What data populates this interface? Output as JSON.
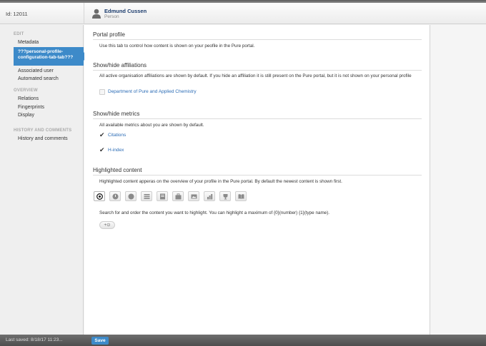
{
  "header": {
    "id_label": "Id: 12011",
    "person_name": "Edmund Cussen",
    "person_type": "Person"
  },
  "sidebar": {
    "sections": [
      {
        "title": "EDIT"
      },
      {
        "title": "OVERVIEW"
      },
      {
        "title": "HISTORY AND COMMENTS"
      }
    ],
    "items": [
      {
        "label": "Metadata"
      },
      {
        "label": "???personal-profile-configuration-tab-tab???"
      },
      {
        "label": "Associated user"
      },
      {
        "label": "Automated search"
      },
      {
        "label": "Relations"
      },
      {
        "label": "Fingerprints"
      },
      {
        "label": "Display"
      },
      {
        "label": "History and comments"
      }
    ],
    "accent_color": "#3d8ac9"
  },
  "main": {
    "portal_profile": {
      "title": "Portal profile",
      "description": "Use this tab to control how content is shown on your peofile in the Pure portal."
    },
    "affiliations": {
      "title": "Show/hide affiliations",
      "description": "All active organisation affiliations are shown by default. If you hide an affiliation it is still present on the Pure portal, but it is not shown on your personal profile",
      "items": [
        {
          "label": "Department of Pure and Applied Chemistry",
          "checked": false
        }
      ]
    },
    "metrics": {
      "title": "Show/hide metrics",
      "description": "All available metrics about you are shown by default.",
      "items": [
        {
          "label": "Citations",
          "checked": true
        },
        {
          "label": "H-index",
          "checked": true
        }
      ]
    },
    "highlighted": {
      "title": "Highlighted content",
      "description": "Highlighted content apperas on the overview of your profile in the Pure portal. By default the newest content is shown first.",
      "content_types": [
        {
          "icon": "target-icon",
          "active": true
        },
        {
          "icon": "circle-icon",
          "active": false
        },
        {
          "icon": "circle-icon",
          "active": false
        },
        {
          "icon": "list-icon",
          "active": false
        },
        {
          "icon": "document-icon",
          "active": false
        },
        {
          "icon": "briefcase-icon",
          "active": false
        },
        {
          "icon": "image-icon",
          "active": false
        },
        {
          "icon": "bar-chart-icon",
          "active": false
        },
        {
          "icon": "trophy-icon",
          "active": false
        },
        {
          "icon": "book-icon",
          "active": false
        }
      ],
      "search_text": "Search for and order the content you want to highlight. You can highlight a maximum of {0}(number) {1}(type name).",
      "add_label": "+⊙"
    }
  },
  "footer": {
    "last_saved": "Last saved: 8/18/17 11:23...",
    "save_label": "Save"
  }
}
